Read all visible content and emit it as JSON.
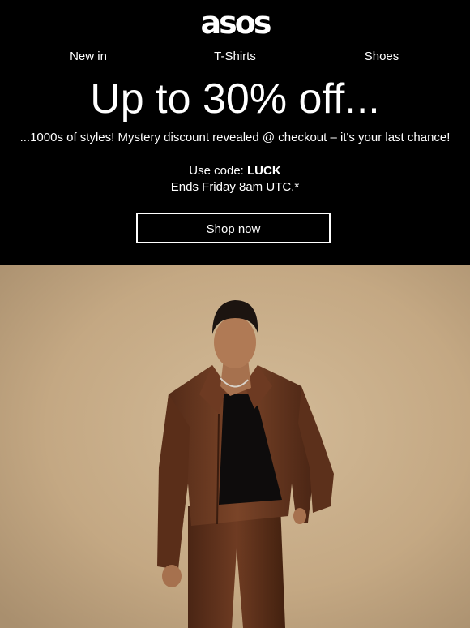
{
  "brand": {
    "logo_text": "asos"
  },
  "nav": {
    "items": [
      {
        "label": "New in"
      },
      {
        "label": "T-Shirts"
      },
      {
        "label": "Shoes"
      }
    ]
  },
  "promo": {
    "headline": "Up to 30% off...",
    "subline": "...1000s of styles! Mystery discount revealed @ checkout – it's your last chance!",
    "code_prefix": "Use code: ",
    "code": "LUCK",
    "ends": "Ends Friday 8am UTC.*",
    "cta_label": "Shop now"
  },
  "colors": {
    "background": "#000000",
    "text": "#ffffff",
    "hero_backdrop": "#c8ad8a",
    "outfit": "#6b3a22"
  }
}
